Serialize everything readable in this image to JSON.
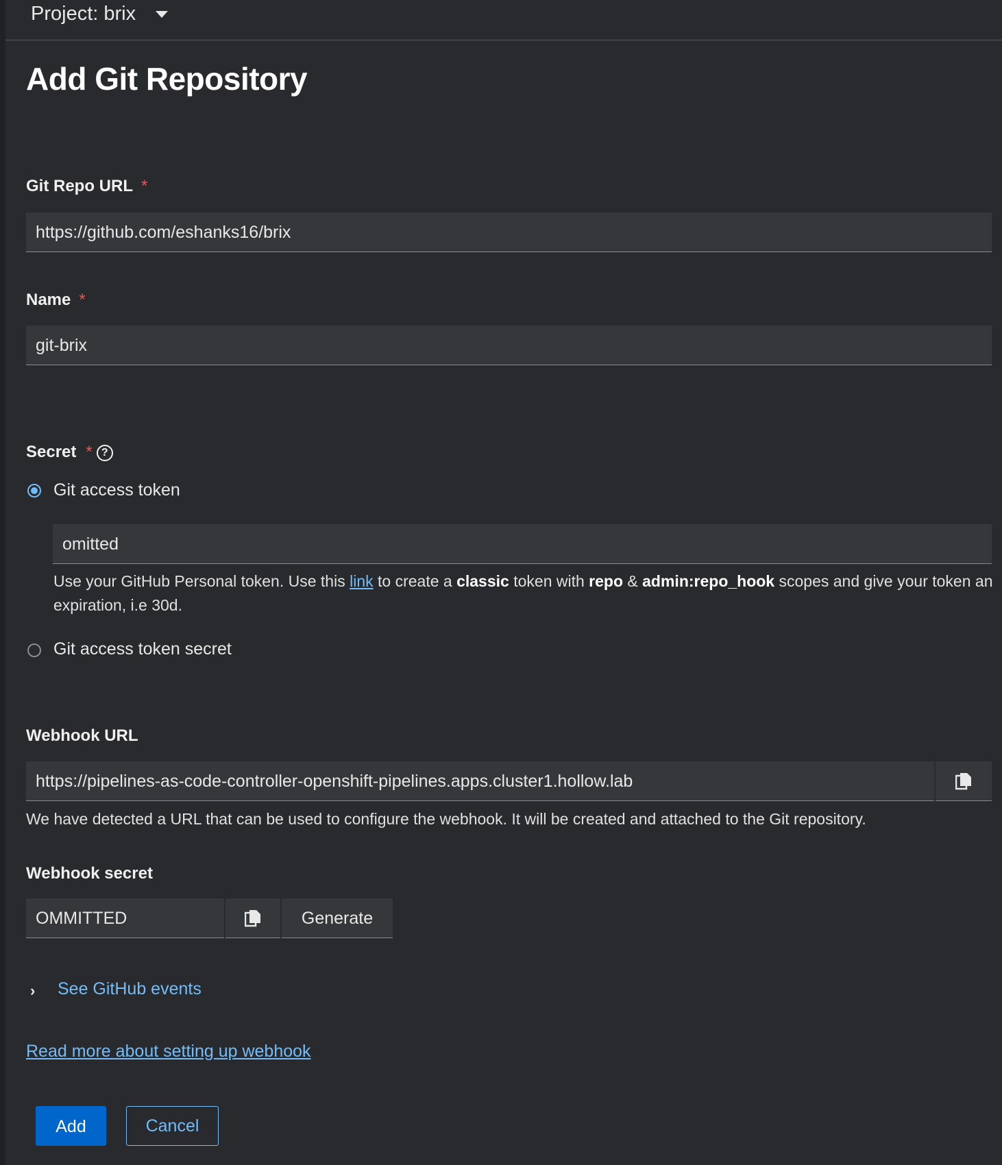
{
  "header": {
    "project_label": "Project: brix",
    "title": "Add Git Repository"
  },
  "form": {
    "repo_url": {
      "label": "Git Repo URL",
      "required": "*",
      "value": "https://github.com/eshanks16/brix"
    },
    "name": {
      "label": "Name",
      "required": "*",
      "value": "git-brix"
    },
    "secret": {
      "label": "Secret",
      "required": "*",
      "help_icon": "?",
      "option_token": "Git access token",
      "token_value": "omitted",
      "helper_1": "Use your GitHub Personal token. Use this ",
      "helper_link": "link",
      "helper_2": " to create a ",
      "helper_bold_1": "classic",
      "helper_3": " token with ",
      "helper_bold_2": "repo",
      "helper_4": " & ",
      "helper_bold_3": "admin:repo_hook",
      "helper_5": " scopes and give your token an expiration, i.e 30d.",
      "option_secret": "Git access token secret"
    },
    "webhook_url": {
      "label": "Webhook URL",
      "value": "https://pipelines-as-code-controller-openshift-pipelines.apps.cluster1.hollow.lab",
      "helper": "We have detected a URL that can be used to configure the webhook. It will be created and attached to the Git repository."
    },
    "webhook_secret": {
      "label": "Webhook secret",
      "value": "OMMITTED",
      "generate_label": "Generate"
    },
    "github_events_label": "See GitHub events",
    "read_more_label": "Read more about setting up webhook"
  },
  "actions": {
    "add_label": "Add",
    "cancel_label": "Cancel"
  },
  "colors": {
    "accent": "#73bcf7",
    "primary": "#0066cc",
    "required": "#e05a5a",
    "background": "#292a2d"
  }
}
